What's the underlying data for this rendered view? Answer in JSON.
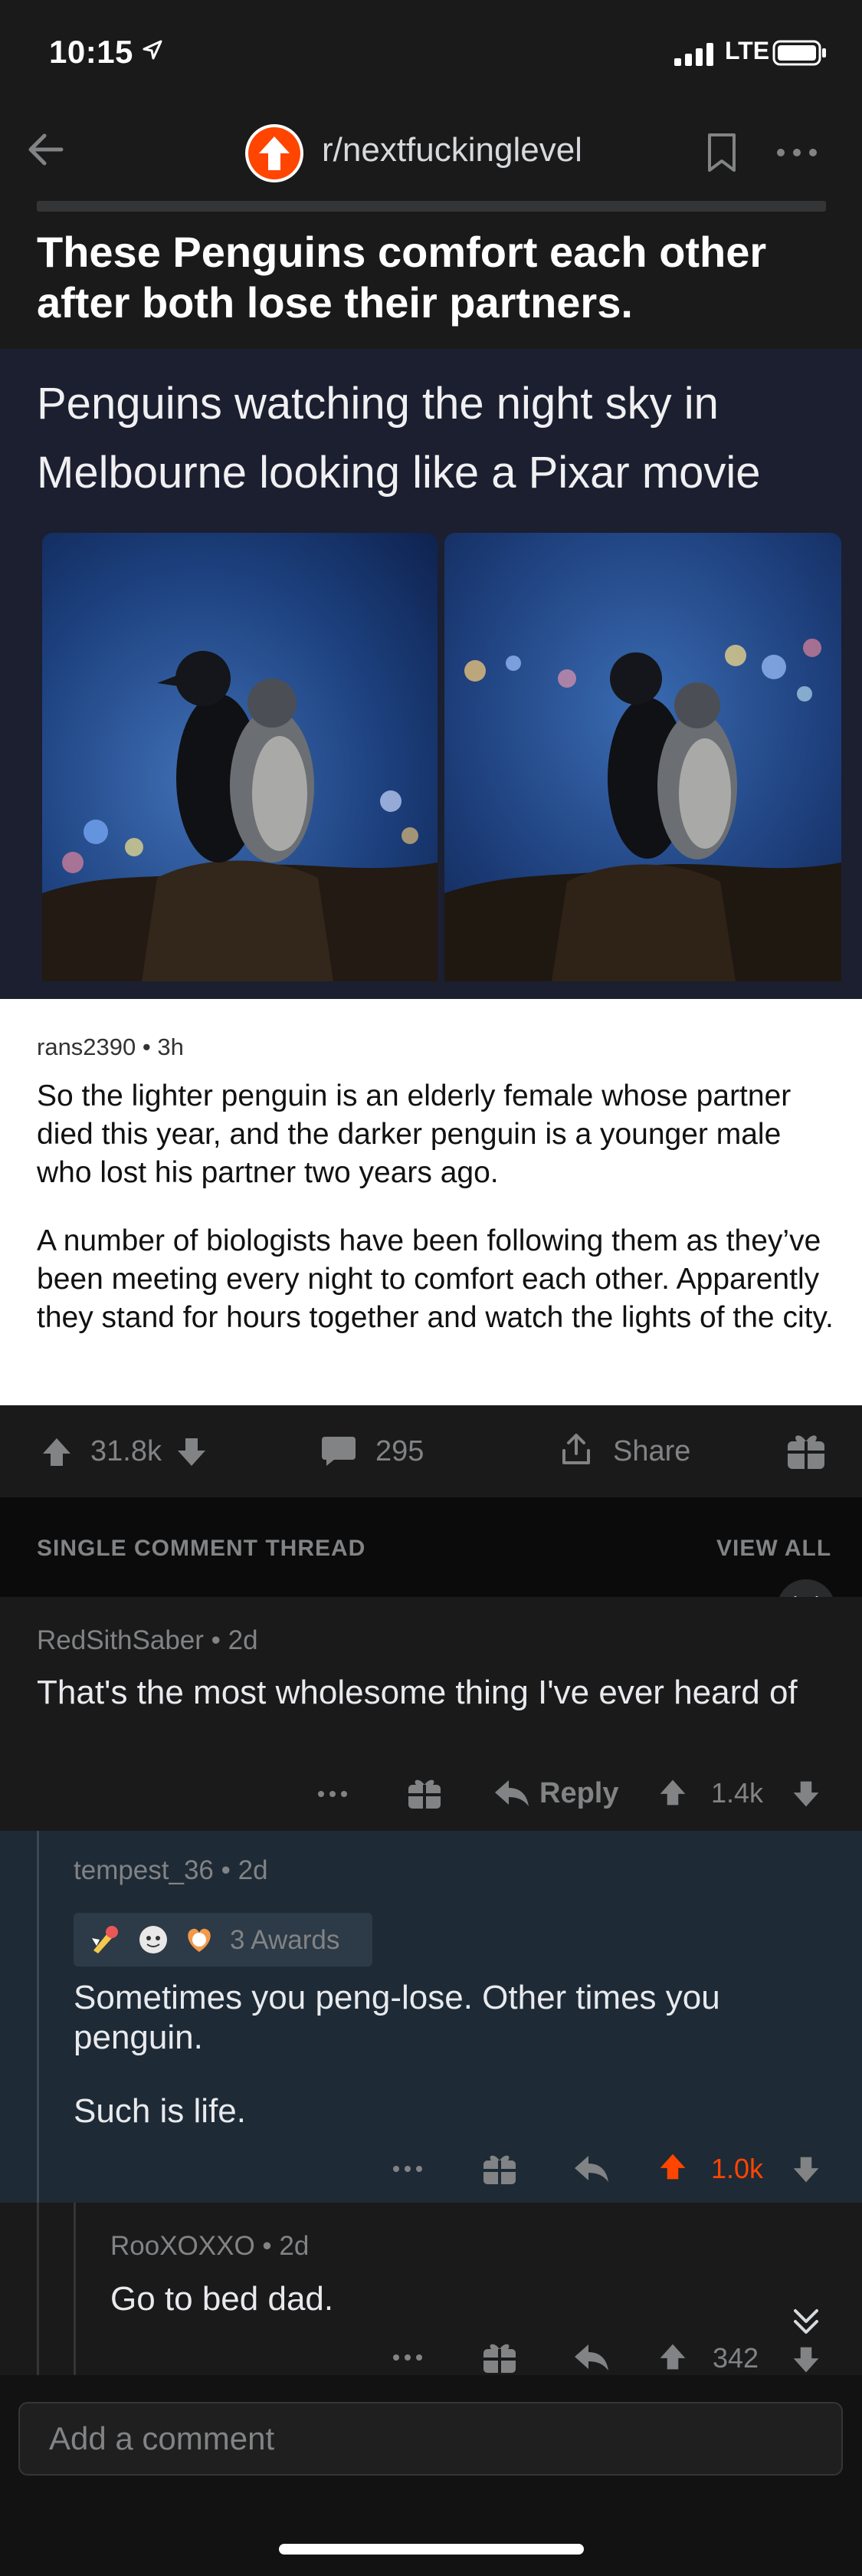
{
  "status_bar": {
    "time": "10:15",
    "network": "LTE"
  },
  "header": {
    "subreddit": "r/nextfuckinglevel"
  },
  "post": {
    "title": "These Penguins comfort each other after both lose their partners.",
    "image_caption": "Penguins watching the night sky in Melbourne looking like a Pixar movie",
    "quoted_meta": "rans2390 • 3h",
    "quoted_paragraph_1": "So the lighter penguin is an elderly female whose partner died this year, and the darker penguin is a younger male who lost his partner two years ago.",
    "quoted_paragraph_2": "A number of biologists have been following them as they’ve been meeting every night to comfort each other. Apparently they stand for hours together and watch the lights of the city.",
    "votes": "31.8k",
    "comments": "295",
    "share_label": "Share"
  },
  "thread": {
    "label": "SINGLE COMMENT THREAD",
    "view_all": "VIEW ALL"
  },
  "comments": [
    {
      "meta": "RedSithSaber • 2d",
      "body": "That's the most wholesome thing I've ever heard of",
      "reply_label": "Reply",
      "votes": "1.4k"
    },
    {
      "meta": "tempest_36 • 2d",
      "awards": "3 Awards",
      "body_1": "Sometimes you peng-lose. Other times you penguin.",
      "body_2": "Such is life.",
      "votes": "1.0k"
    },
    {
      "meta": "RooXOXXO • 2d",
      "body": "Go to bed dad.",
      "votes": "342"
    }
  ],
  "composer": {
    "placeholder": "Add a comment"
  },
  "colors": {
    "upvote_active": "#ff4500",
    "background": "#1a1a1b",
    "highlight_comment": "#1e2a35"
  }
}
